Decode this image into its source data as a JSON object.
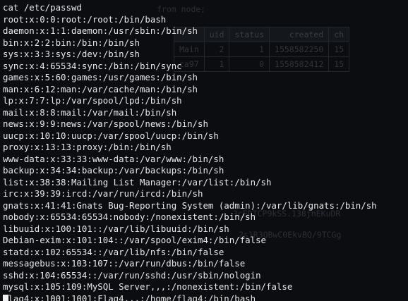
{
  "terminal": {
    "command": "cat /etc/passwd",
    "output_lines": [
      "root:x:0:0:root:/root:/bin/bash",
      "daemon:x:1:1:daemon:/usr/sbin:/bin/sh",
      "bin:x:2:2:bin:/bin:/bin/sh",
      "sys:x:3:3:sys:/dev:/bin/sh",
      "sync:x:4:65534:sync:/bin:/bin/sync",
      "games:x:5:60:games:/usr/games:/bin/sh",
      "man:x:6:12:man:/var/cache/man:/bin/sh",
      "lp:x:7:7:lp:/var/spool/lpd:/bin/sh",
      "mail:x:8:8:mail:/var/mail:/bin/sh",
      "news:x:9:9:news:/var/spool/news:/bin/sh",
      "uucp:x:10:10:uucp:/var/spool/uucp:/bin/sh",
      "proxy:x:13:13:proxy:/bin:/bin/sh",
      "www-data:x:33:33:www-data:/var/www:/bin/sh",
      "backup:x:34:34:backup:/var/backups:/bin/sh",
      "list:x:38:38:Mailing List Manager:/var/list:/bin/sh",
      "irc:x:39:39:ircd:/var/run/ircd:/bin/sh",
      "gnats:x:41:41:Gnats Bug-Reporting System (admin):/var/lib/gnats:/bin/sh",
      "nobody:x:65534:65534:nobody:/nonexistent:/bin/sh",
      "libuuid:x:100:101::/var/lib/libuuid:/bin/sh",
      "Debian-exim:x:101:104::/var/spool/exim4:/bin/false",
      "statd:x:102:65534::/var/lib/nfs:/bin/false",
      "messagebus:x:103:107::/var/run/dbus:/bin/false",
      "sshd:x:104:65534::/var/run/sshd:/usr/sbin/nologin",
      "mysql:x:105:109:MySQL Server,,,:/nonexistent:/bin/false",
      "flag4:x:1001:1001:Flag4,,,:/home/flag4:/bin/bash"
    ]
  },
  "background": {
    "query_text": "from node;",
    "table_headers": [
      "uid",
      "status",
      "created",
      "ch"
    ],
    "table_rows": [
      [
        "Main",
        "2",
        "1",
        "1558582250",
        "15"
      ],
      [
        "ca97",
        "1",
        "0",
        "1558582412",
        "15"
      ]
    ],
    "hash_line_1": "3cEDTCP9kSS.138jnEKuDR",
    "hash_line_2": "2s1R3QBwC0EkvBQ/9TCGg"
  },
  "colors": {
    "background": "#0b0d10",
    "text": "#e8e8e8",
    "cursor": "#f2f2f2"
  }
}
